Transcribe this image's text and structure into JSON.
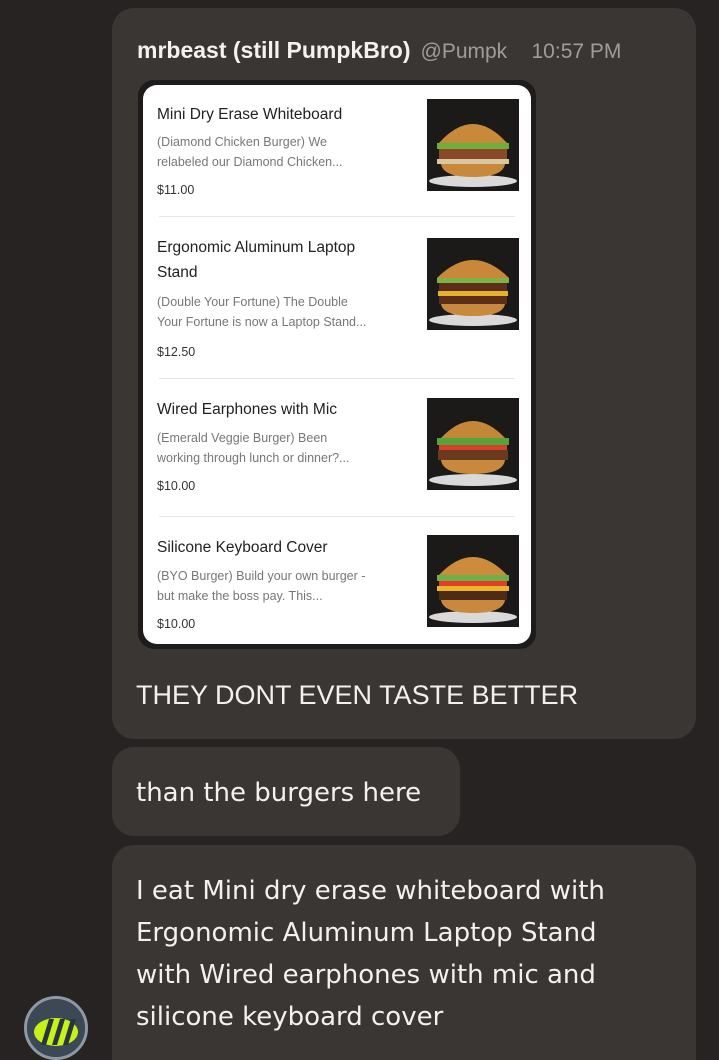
{
  "message": {
    "username": "mrbeast (still PumpkBro)",
    "handle": "@Pumpk",
    "time": "10:57 PM"
  },
  "menu": {
    "items": [
      {
        "title": "Mini Dry Erase Whiteboard",
        "desc_line1": "(Diamond Chicken Burger) We",
        "desc_line2": "relabeled our Diamond Chicken...",
        "price": "$11.00",
        "image": "burger-photo"
      },
      {
        "title_line1": "Ergonomic Aluminum Laptop",
        "title_line2": "Stand",
        "desc_line1": "(Double Your Fortune) The Double",
        "desc_line2": "Your Fortune is now a Laptop Stand...",
        "price": "$12.50",
        "image": "burger-photo"
      },
      {
        "title": "Wired Earphones with Mic",
        "desc_line1": "(Emerald Veggie Burger) Been",
        "desc_line2": "working through lunch or dinner?...",
        "price": "$10.00",
        "image": "burger-photo"
      },
      {
        "title": "Silicone Keyboard Cover",
        "desc_line1": "(BYO Burger) Build your own burger -",
        "desc_line2": "but make the boss pay. This...",
        "price": "$10.00",
        "image": "burger-photo"
      }
    ]
  },
  "messages": {
    "m1": "THEY DONT EVEN TASTE BETTER",
    "m2": "than the burgers here",
    "m3_line1": "I eat Mini dry erase whiteboard with",
    "m3_line2": "Ergonomic Aluminum Laptop Stand",
    "m3_line3": "with Wired earphones with mic and",
    "m3_line4": "silicone keyboard cover"
  },
  "colors": {
    "background": "#262322",
    "bubble": "#3a3634",
    "avatar_accent": "#c6f21a"
  }
}
